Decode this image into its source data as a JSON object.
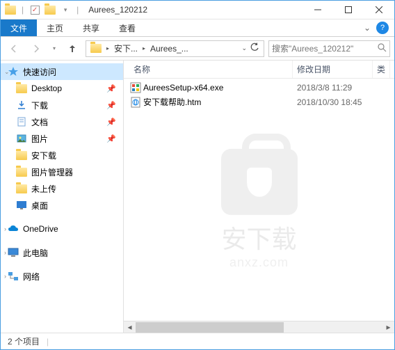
{
  "title": "Aurees_120212",
  "tabs": {
    "file": "文件",
    "home": "主页",
    "share": "共享",
    "view": "查看"
  },
  "breadcrumb": {
    "seg1": "安下...",
    "seg2": "Aurees_..."
  },
  "search": {
    "placeholder": "搜索\"Aurees_120212\""
  },
  "columns": {
    "name": "名称",
    "date": "修改日期",
    "type": "类"
  },
  "sidebar": {
    "quick": "快速访问",
    "items": [
      {
        "label": "Desktop"
      },
      {
        "label": "下载"
      },
      {
        "label": "文档"
      },
      {
        "label": "图片"
      },
      {
        "label": "安下载"
      },
      {
        "label": "图片管理器"
      },
      {
        "label": "未上传"
      },
      {
        "label": "桌面"
      }
    ],
    "onedrive": "OneDrive",
    "thispc": "此电脑",
    "network": "网络"
  },
  "files": [
    {
      "name": "AureesSetup-x64.exe",
      "date": "2018/3/8 11:29",
      "icon": "installer"
    },
    {
      "name": "安下载帮助.htm",
      "date": "2018/10/30 18:45",
      "icon": "htm"
    }
  ],
  "status": {
    "count": "2 个项目"
  },
  "watermark": {
    "text": "安下载",
    "sub": "anxz.com"
  }
}
